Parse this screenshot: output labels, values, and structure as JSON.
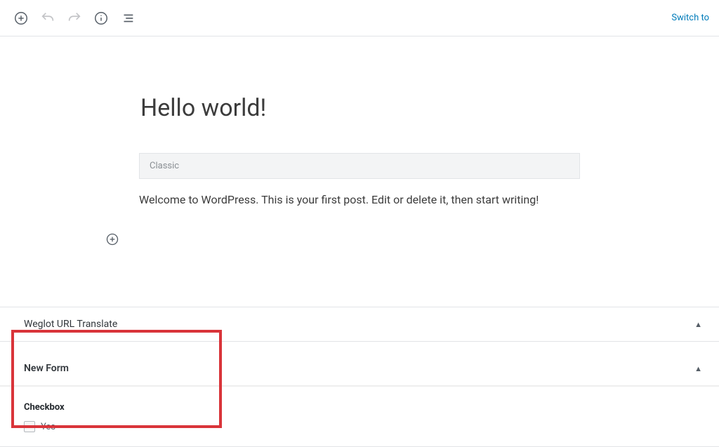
{
  "toolbar": {
    "switch_label": "Switch to"
  },
  "post": {
    "title": "Hello world!",
    "classic_label": "Classic",
    "body": "Welcome to WordPress. This is your first post. Edit or delete it, then start writing!"
  },
  "panels": {
    "weglot": {
      "title": "Weglot URL Translate"
    },
    "newform": {
      "title": "New Form",
      "field_label": "Checkbox",
      "option_label": "Yes"
    }
  }
}
